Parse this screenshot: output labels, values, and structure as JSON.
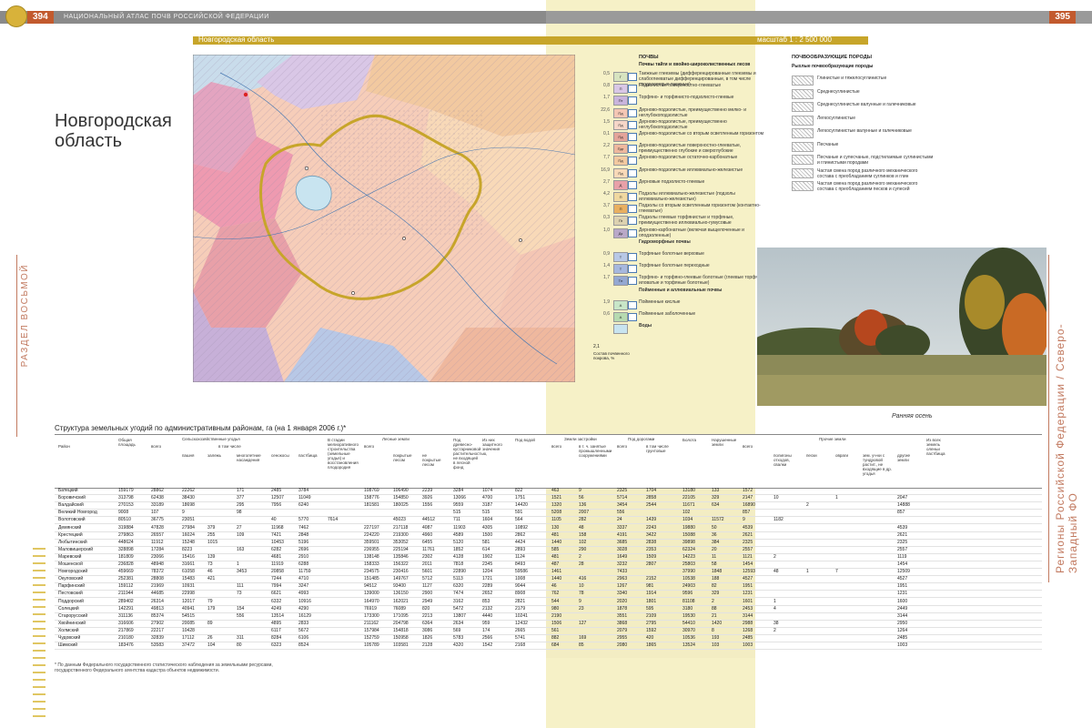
{
  "header": {
    "page_left": "394",
    "page_right": "395",
    "running_head": "НАЦИОНАЛЬНЫЙ АТЛАС ПОЧВ РОССИЙСКОЙ ФЕДЕРАЦИИ",
    "region_bar": "Новгородская область",
    "scale": "масштаб 1 : 2 500 000"
  },
  "title": "Новгородская область",
  "side_left": "РАЗДЕЛ ВОСЬМОЙ",
  "side_right": "Регионы Российской Федерации / Северо-Западный ФО",
  "legend": {
    "soils_title": "ПОЧВЫ",
    "soils_subtitle": "Почвы тайги и хвойно-широколиственных лесов",
    "items": [
      {
        "num": "0,5",
        "sym": "Г",
        "color": "#d7e4c0",
        "text": "Таежные глееземы (дифференцированные глееземы и слабоглееватые дифференцированные, в том числе сподосолевые таежные)"
      },
      {
        "num": "0,8",
        "sym": "П",
        "color": "#d9c7e6",
        "text": "Подзолистые поверхностно-глееватые"
      },
      {
        "num": "1,7",
        "sym": "Пт",
        "color": "#c9b4dc",
        "text": "Торфяно- и торфянисто-подзолисто-глеевые"
      },
      {
        "num": "22,6",
        "sym": "Пд",
        "color": "#f4c6b4",
        "text": "Дерново-подзолистые, преимущественно мелко- и неглубокоподзолистые"
      },
      {
        "num": "1,5",
        "sym": "Пд",
        "color": "#f6d6c8",
        "text": "Дерново-подзолистые, преимущественно неглубокоподзолистые"
      },
      {
        "num": "0,1",
        "sym": "Пд",
        "color": "#e4a49a",
        "text": "Дерново-подзолистые со вторым осветленным горизонтом"
      },
      {
        "num": "2,2",
        "sym": "Пдг",
        "color": "#efb89e",
        "text": "Дерново-подзолистые поверхностно-глееватые, преимущественно глубокие и сверхглубокие"
      },
      {
        "num": "7,7",
        "sym": "Пд",
        "color": "#f2c9a0",
        "text": "Дерново-подзолистые остаточно-карбонатные"
      },
      {
        "num": "16,9",
        "sym": "Пд",
        "color": "#f8d9b8",
        "text": "Дерново-подзолистые иллювиально-железистые"
      },
      {
        "num": "2,7",
        "sym": "Д",
        "color": "#e8a0a8",
        "text": "Дерновые подзолисто-глеевые"
      },
      {
        "num": "4,2",
        "sym": "П",
        "color": "#f0d8a0",
        "text": "Подзолы иллювиально-железистые (подзолы иллювиально-железистые)"
      },
      {
        "num": "3,7",
        "sym": "П",
        "color": "#e9b060",
        "text": "Подзолы со вторым осветленным горизонтом (контактно-глееватые)"
      },
      {
        "num": "0,3",
        "sym": "Пг",
        "color": "#ddd2b0",
        "text": "Подзолы глеевые торфянистые и торфяные, преимущественно иллювиально-гумусовые"
      },
      {
        "num": "1,0",
        "sym": "Дк",
        "color": "#b9a8c8",
        "text": "Дерново-карбонатные (включая выщелоченные и оподзоленные)"
      },
      {
        "num": "",
        "sym": "",
        "color": "#ffffff",
        "text": "Гидроморфные почвы"
      },
      {
        "num": "0,9",
        "sym": "Т",
        "color": "#b8c8e6",
        "text": "Торфяные болотные верховые"
      },
      {
        "num": "1,4",
        "sym": "Т",
        "color": "#a6b8de",
        "text": "Торфяные болотные переходные"
      },
      {
        "num": "1,7",
        "sym": "Тн",
        "color": "#94a8d2",
        "text": "Торфяно- и торфяно-глеевые болотные (глеевые торфяно-иловатые и торфяные болотные)"
      },
      {
        "num": "",
        "sym": "",
        "color": "#ffffff",
        "text": "Пойменные и аллювиальные почвы"
      },
      {
        "num": "1,9",
        "sym": "А",
        "color": "#c8e6c8",
        "text": "Пойменные кислые"
      },
      {
        "num": "0,6",
        "sym": "А",
        "color": "#b6dab0",
        "text": "Пойменные заболоченные"
      },
      {
        "num": "",
        "sym": "",
        "color": "#c8e4f0",
        "text": "Воды"
      }
    ],
    "note_num": "2,1",
    "note_text": "Состав почвенного покрова, %"
  },
  "rocks": {
    "title": "ПОЧВООБРАЗУЮЩИЕ ПОРОДЫ",
    "subtitle": "Рыхлые почвообразующие породы",
    "items": [
      "Глинистые и тяжелосуглинистые",
      "Среднесуглинистые",
      "Среднесуглинистые валунные и галечниковые",
      "Легкосуглинистые",
      "Легкосуглинистые валунные и галечниковые",
      "Песчаные",
      "Песчаные и супесчаные, подстилаемые суглинистыми и глинистыми породами",
      "Частая смена пород различного механического состава с преобладанием суглинков и глин",
      "Частая смена пород различного механического состава с преобладанием песков и супесей"
    ]
  },
  "photo_caption": "Ранняя осень",
  "table": {
    "title": "Структура земельных угодий по административным районам, га (на 1 января 2006 г.)*",
    "headers": {
      "rayon": "Район",
      "total": "Общая площадь",
      "agri": "Сельскохозяйственные угодья",
      "agri_total": "всего",
      "incl": "в том числе",
      "arable": "пашня",
      "fallow": "залежь",
      "perennial": "многолетние насаждения",
      "hay": "сенокосы",
      "pasture": "пастбища",
      "constr": "В стадии мелиоративного строительства (земельные угодья) и восстановления плодородия",
      "forest": "Лесные земли",
      "forest_total": "всего",
      "covered": "покрытые лесом",
      "uncovered": "не покрытые лесом",
      "shrub": "Под древесно-кустарниковой растительностью, не входящей в лесной фонд",
      "swamp": "Из них защитного значения",
      "water": "Под водой",
      "built": "Земли застройки",
      "built_total": "всего",
      "built_incl": "в т. ч. занятые промышленными сооружениями",
      "roads": "Под дорогами",
      "roads_total": "всего",
      "roads_incl": "в том числе грунтовые",
      "bogs": "Болота",
      "disturbed": "Нарушенные земли",
      "other": "Прочие земли",
      "other_total": "всего",
      "polygons": "полигоны отходов, свалки",
      "sands": "пески",
      "ravines": "овраги",
      "other_sub": "зем. уч-ки с тундровой растит., не входящие в др. угодья",
      "other_land": "другие земли",
      "reindeer": "Из всех земель оленьи пастбища"
    },
    "rows": [
      [
        "Батецкий",
        "159179",
        "28862",
        "22262",
        "",
        "171",
        "2485",
        "3784",
        "",
        "108769",
        "106490",
        "2239",
        "3284",
        "1074",
        "822",
        "463",
        "9",
        "2325",
        "1704",
        "13180",
        "133",
        "1572",
        "",
        "",
        "",
        "",
        ""
      ],
      [
        "Боровичский",
        "313798",
        "62438",
        "38430",
        "",
        "377",
        "12507",
        "11049",
        "",
        "158776",
        "154850",
        "3926",
        "13066",
        "4700",
        "1751",
        "1521",
        "56",
        "5714",
        "2858",
        "22105",
        "329",
        "2147",
        "10",
        "",
        "1",
        "",
        "2047"
      ],
      [
        "Валдайский",
        "270153",
        "33189",
        "18698",
        "",
        "295",
        "7956",
        "6240",
        "",
        "181581",
        "180025",
        "1556",
        "9559",
        "3187",
        "14420",
        "1320",
        "136",
        "3454",
        "2544",
        "11671",
        "634",
        "16890",
        "",
        "2",
        "",
        "",
        "14888"
      ],
      [
        "Великий Новгород",
        "9008",
        "107",
        "9",
        "",
        "98",
        "",
        "",
        "",
        "",
        "",
        "",
        "515",
        "515",
        "591",
        "5208",
        "2007",
        "556",
        "",
        "102",
        "",
        "857",
        "",
        "",
        "",
        "",
        "857"
      ],
      [
        "Волотовский",
        "80510",
        "36775",
        "23051",
        "",
        "",
        "40",
        "5770",
        "7614",
        "",
        "45023",
        "44512",
        "711",
        "1604",
        "564",
        "1105",
        "282",
        "24",
        "1439",
        "1034",
        "11572",
        "9",
        "1182",
        "",
        "",
        "",
        "",
        "1182"
      ],
      [
        "Демянский",
        "319884",
        "47828",
        "27984",
        "379",
        "27",
        "11968",
        "7462",
        "",
        "227197",
        "217118",
        "4087",
        "11903",
        "4305",
        "10892",
        "130",
        "48",
        "3337",
        "2243",
        "19880",
        "50",
        "4539",
        "",
        "",
        "",
        "",
        "4539"
      ],
      [
        "Крестецкий",
        "279863",
        "26557",
        "16024",
        "255",
        "109",
        "7421",
        "2848",
        "",
        "224220",
        "219300",
        "4960",
        "4589",
        "1500",
        "2862",
        "481",
        "158",
        "4191",
        "3422",
        "15088",
        "36",
        "2621",
        "",
        "",
        "",
        "",
        "2621"
      ],
      [
        "Любытинский",
        "448624",
        "11912",
        "15248",
        "1015",
        "",
        "10453",
        "5196",
        "",
        "359501",
        "353052",
        "6455",
        "5120",
        "581",
        "4424",
        "1440",
        "102",
        "3685",
        "2838",
        "39898",
        "384",
        "2325",
        "",
        "",
        "",
        "",
        "2325"
      ],
      [
        "Маловишерский",
        "328898",
        "17284",
        "8223",
        "",
        "163",
        "6282",
        "2696",
        "",
        "236955",
        "225194",
        "11761",
        "1852",
        "614",
        "2893",
        "585",
        "290",
        "3028",
        "2353",
        "62324",
        "20",
        "2557",
        "",
        "",
        "",
        "",
        "2557"
      ],
      [
        "Маревский",
        "181809",
        "23066",
        "15416",
        "139",
        "",
        "4681",
        "2910",
        "",
        "138148",
        "135846",
        "2302",
        "4128",
        "1902",
        "1124",
        "481",
        "2",
        "1649",
        "1509",
        "14223",
        "11",
        "1121",
        "2",
        "",
        "",
        "",
        "1119"
      ],
      [
        "Мошенской",
        "236828",
        "48948",
        "31661",
        "73",
        "1",
        "11919",
        "6288",
        "",
        "158333",
        "156322",
        "2011",
        "7818",
        "2345",
        "8493",
        "487",
        "28",
        "3232",
        "2807",
        "25803",
        "58",
        "1454",
        "",
        "",
        "",
        "",
        "1454"
      ],
      [
        "Новгородский",
        "459669",
        "78372",
        "61058",
        "46",
        "3453",
        "20858",
        "11759",
        "",
        "234575",
        "230416",
        "5601",
        "22890",
        "1204",
        "59586",
        "1461",
        "",
        "7433",
        "",
        "37990",
        "1848",
        "12593",
        "48",
        "1",
        "7",
        "",
        "12509"
      ],
      [
        "Окуловский",
        "252381",
        "28808",
        "15483",
        "421",
        "",
        "7244",
        "4710",
        "",
        "151485",
        "149767",
        "5712",
        "5113",
        "1721",
        "1008",
        "1440",
        "416",
        "2963",
        "2152",
        "10538",
        "188",
        "4527",
        "",
        "",
        "",
        "",
        "4527"
      ],
      [
        "Парфинский",
        "159112",
        "21969",
        "10931",
        "",
        "111",
        "7994",
        "3247",
        "",
        "94512",
        "93400",
        "1127",
        "6320",
        "2289",
        "9044",
        "46",
        "10",
        "1267",
        "981",
        "24903",
        "82",
        "1951",
        "",
        "",
        "",
        "",
        "1951"
      ],
      [
        "Пестовский",
        "211944",
        "44685",
        "22998",
        "",
        "73",
        "6621",
        "4993",
        "",
        "139000",
        "136150",
        "2900",
        "7474",
        "2652",
        "8908",
        "762",
        "78",
        "3340",
        "1914",
        "9596",
        "329",
        "1231",
        "",
        "",
        "",
        "",
        "1231"
      ],
      [
        "Поддорский",
        "289402",
        "26314",
        "12017",
        "79",
        "",
        "6332",
        "10916",
        "",
        "164970",
        "162021",
        "2949",
        "3162",
        "853",
        "2821",
        "544",
        "9",
        "2020",
        "1801",
        "81108",
        "2",
        "1601",
        "1",
        "",
        "",
        "",
        "1600"
      ],
      [
        "Солецкий",
        "142291",
        "49813",
        "40941",
        "179",
        "154",
        "4249",
        "4290",
        "",
        "76919",
        "76089",
        "820",
        "5472",
        "2132",
        "2179",
        "980",
        "23",
        "1878",
        "595",
        "3180",
        "88",
        "2453",
        "4",
        "",
        "",
        "",
        "2449"
      ],
      [
        "Старорусский",
        "311136",
        "85374",
        "54515",
        "",
        "556",
        "13514",
        "16129",
        "",
        "173300",
        "171095",
        "2213",
        "13807",
        "4440",
        "10241",
        "2190",
        "",
        "3551",
        "2109",
        "19530",
        "21",
        "3144",
        "",
        "",
        "",
        "",
        "3144"
      ],
      [
        "Хвойнинский",
        "316606",
        "27902",
        "20085",
        "89",
        "",
        "4895",
        "2833",
        "",
        "211162",
        "204798",
        "6364",
        "2634",
        "959",
        "12432",
        "1506",
        "127",
        "3868",
        "2795",
        "54410",
        "1420",
        "2988",
        "38",
        "",
        "",
        "",
        "2950"
      ],
      [
        "Холмский",
        "217869",
        "22217",
        "10428",
        "",
        "",
        "6117",
        "5672",
        "",
        "157984",
        "154818",
        "3086",
        "569",
        "174",
        "2665",
        "561",
        "",
        "2079",
        "1592",
        "30970",
        "8",
        "1268",
        "2",
        "",
        "",
        "",
        "1264"
      ],
      [
        "Чудовский",
        "210180",
        "32839",
        "17112",
        "26",
        "311",
        "8284",
        "6106",
        "",
        "152759",
        "150958",
        "1826",
        "5783",
        "2566",
        "5741",
        "882",
        "169",
        "2955",
        "420",
        "10536",
        "193",
        "2485",
        "",
        "",
        "",
        "",
        "2485"
      ],
      [
        "Шимский",
        "183476",
        "53583",
        "37472",
        "104",
        "80",
        "6323",
        "8524",
        "",
        "105789",
        "103581",
        "2128",
        "4320",
        "1542",
        "2168",
        "684",
        "85",
        "2080",
        "1865",
        "13524",
        "103",
        "1003",
        "",
        "",
        "",
        "",
        "1003"
      ]
    ]
  },
  "footnote": "* По данным Федерального государственного статистического наблюдения за земельными ресурсами, государственного Федерального агентства кадастра объектов недвижимости.",
  "colors": {
    "accent_gold": "#c7a52a",
    "page_number_bg": "#c25a2e",
    "side_text": "#c27a60",
    "right_tint": "#f6f1c7"
  }
}
